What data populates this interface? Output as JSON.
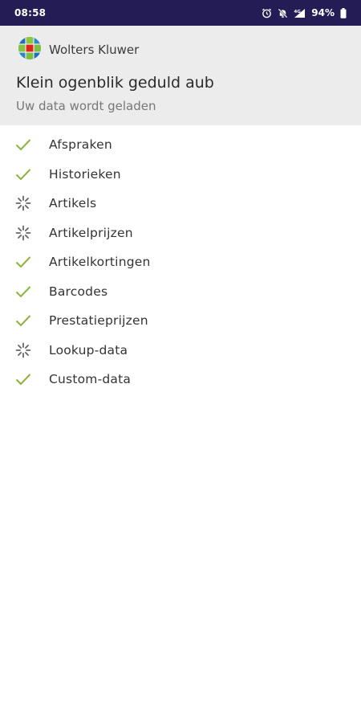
{
  "status_bar": {
    "time": "08:58",
    "battery": "94%",
    "icons": [
      "alarm-icon",
      "bell-muted-icon",
      "signal-icon",
      "battery-icon"
    ]
  },
  "header": {
    "brand": "Wolters Kluwer",
    "title": "Klein ogenblik geduld aub",
    "subtitle": "Uw data wordt geladen"
  },
  "colors": {
    "status_bar": "#241c55",
    "header_bg": "#ececec",
    "check": "#8bb33c",
    "spinner": "#666666"
  },
  "items": [
    {
      "label": "Afspraken",
      "status": "done",
      "icon": "check-icon"
    },
    {
      "label": "Historieken",
      "status": "done",
      "icon": "check-icon"
    },
    {
      "label": "Artikels",
      "status": "loading",
      "icon": "spinner-icon"
    },
    {
      "label": "Artikelprijzen",
      "status": "loading",
      "icon": "spinner-icon"
    },
    {
      "label": "Artikelkortingen",
      "status": "done",
      "icon": "check-icon"
    },
    {
      "label": "Barcodes",
      "status": "done",
      "icon": "check-icon"
    },
    {
      "label": "Prestatieprijzen",
      "status": "done",
      "icon": "check-icon"
    },
    {
      "label": "Lookup-data",
      "status": "loading",
      "icon": "spinner-icon"
    },
    {
      "label": "Custom-data",
      "status": "done",
      "icon": "check-icon"
    }
  ]
}
